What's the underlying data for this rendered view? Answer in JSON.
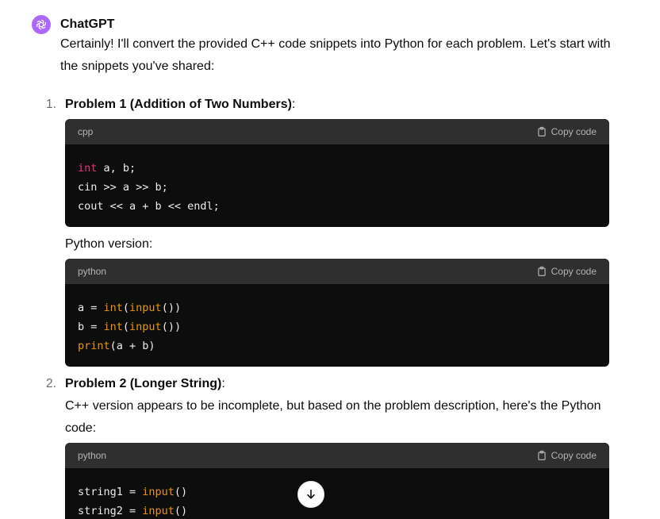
{
  "message": {
    "author": "ChatGPT",
    "intro": "Certainly! I'll convert the provided C++ code snippets into Python for each problem. Let's start with the snippets you've shared:"
  },
  "problem1": {
    "number": "1.",
    "title": "Problem 1 (Addition of Two Numbers)",
    "suffix": ":",
    "cpp_block": {
      "lang": "cpp",
      "copy_label": "Copy code",
      "lines": [
        [
          {
            "t": "int",
            "c": "kw"
          },
          {
            "t": " a, b;"
          }
        ],
        [
          {
            "t": "cin >> a >> b;"
          }
        ],
        [
          {
            "t": "cout << a + b << endl;"
          }
        ]
      ]
    },
    "python_label": "Python version:",
    "py_block": {
      "lang": "python",
      "copy_label": "Copy code",
      "lines": [
        [
          {
            "t": "a = "
          },
          {
            "t": "int",
            "c": "bi"
          },
          {
            "t": "("
          },
          {
            "t": "input",
            "c": "bi"
          },
          {
            "t": "())"
          }
        ],
        [
          {
            "t": "b = "
          },
          {
            "t": "int",
            "c": "bi"
          },
          {
            "t": "("
          },
          {
            "t": "input",
            "c": "bi"
          },
          {
            "t": "())"
          }
        ],
        [
          {
            "t": "print",
            "c": "bi"
          },
          {
            "t": "(a + b)"
          }
        ]
      ]
    }
  },
  "problem2": {
    "number": "2.",
    "title": "Problem 2 (Longer String)",
    "suffix": ":",
    "text": "C++ version appears to be incomplete, but based on the problem description, here's the Python code:",
    "py_block": {
      "lang": "python",
      "copy_label": "Copy code",
      "lines": [
        [
          {
            "t": "string1 = "
          },
          {
            "t": "input",
            "c": "bi"
          },
          {
            "t": "()"
          }
        ],
        [
          {
            "t": "string2 = "
          },
          {
            "t": "input",
            "c": "bi"
          },
          {
            "t": "()"
          }
        ]
      ]
    }
  },
  "colors": {
    "avatar": "#ab68ff",
    "code_bg": "#0d0d0d",
    "code_header_bg": "#2f2f2f",
    "keyword": "#f22c78",
    "builtin": "#e9950c"
  },
  "icons": {
    "avatar": "openai-logo-icon",
    "copy": "clipboard-icon",
    "scroll": "arrow-down-icon"
  }
}
